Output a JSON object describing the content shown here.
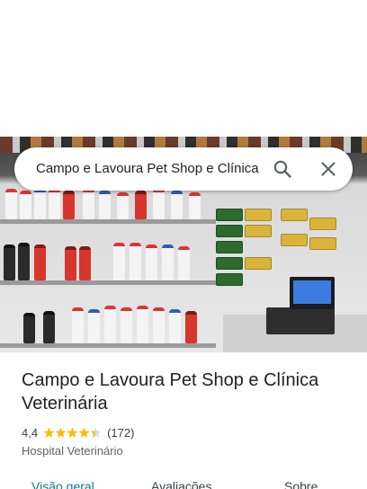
{
  "search": {
    "query": "Campo e Lavoura Pet Shop e Clínica",
    "search_icon": "search-icon",
    "close_icon": "close-icon"
  },
  "place": {
    "name": "Campo e Lavoura Pet Shop e Clínica Veterinária",
    "rating": "4,4",
    "rating_value": 4.4,
    "reviews": "(172)",
    "category": "Hospital Veterinário"
  },
  "tabs": [
    {
      "label": "Visão geral",
      "active": true
    },
    {
      "label": "Avaliações",
      "active": false
    },
    {
      "label": "Sobre",
      "active": false
    }
  ],
  "colors": {
    "accent": "#0b7a8a",
    "star": "#fbbc04",
    "text": "#202124",
    "muted": "#5f6368"
  }
}
